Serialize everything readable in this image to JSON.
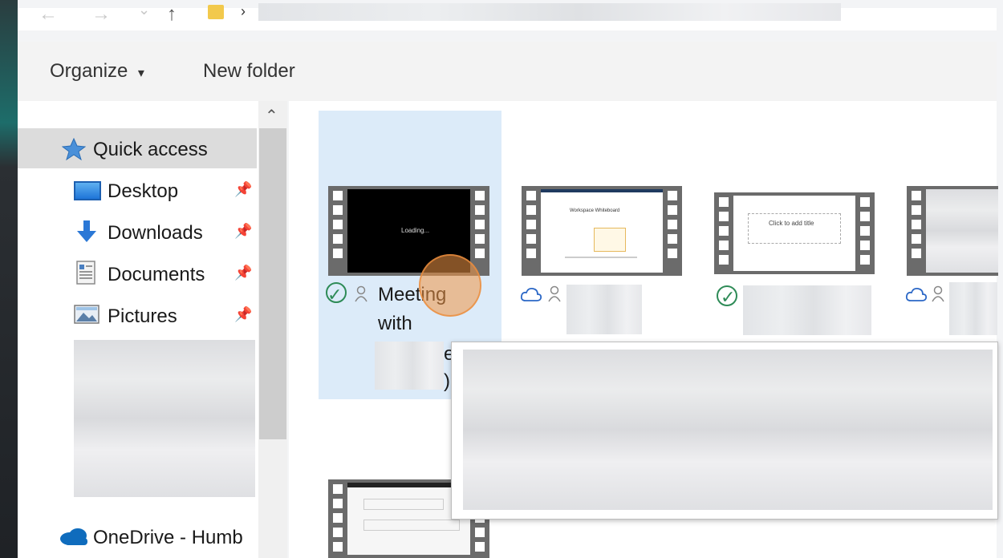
{
  "nav_buttons": {
    "back": "←",
    "forward": "→",
    "recent": "⌄",
    "up": "↑",
    "breadcrumb_chevron": "›"
  },
  "commands": {
    "organize": "Organize",
    "organize_caret": "▾",
    "new_folder": "New folder"
  },
  "nav_pane": {
    "scroll_up": "⌃",
    "quick_access": "Quick access",
    "items": [
      {
        "label": "Desktop",
        "icon": "desktop-icon",
        "pin": "pin-icon"
      },
      {
        "label": "Downloads",
        "icon": "download-arrow-icon",
        "pin": "pin-icon"
      },
      {
        "label": "Documents",
        "icon": "document-icon",
        "pin": "pin-icon"
      },
      {
        "label": "Pictures",
        "icon": "pictures-icon",
        "pin": "pin-icon"
      }
    ],
    "onedrive": "OneDrive - Humb"
  },
  "files": [
    {
      "name_line1": "Meeting",
      "name_line2": "with",
      "frag1": "e",
      "frag2": ")",
      "status": "synced",
      "thumb_text": "Loading..."
    },
    {
      "name_line1": "",
      "status": "cloud",
      "thumb_text": "Workspace Whiteboard"
    },
    {
      "name_line1": "",
      "status": "synced",
      "thumb_text": "Click to add title"
    },
    {
      "name_line1": "",
      "status": "cloud",
      "thumb_text": ""
    }
  ],
  "colors": {
    "accent": "#2b67c6",
    "selection": "#dcebf9",
    "synced": "#2e8b57",
    "cursor": "#f0964a"
  }
}
